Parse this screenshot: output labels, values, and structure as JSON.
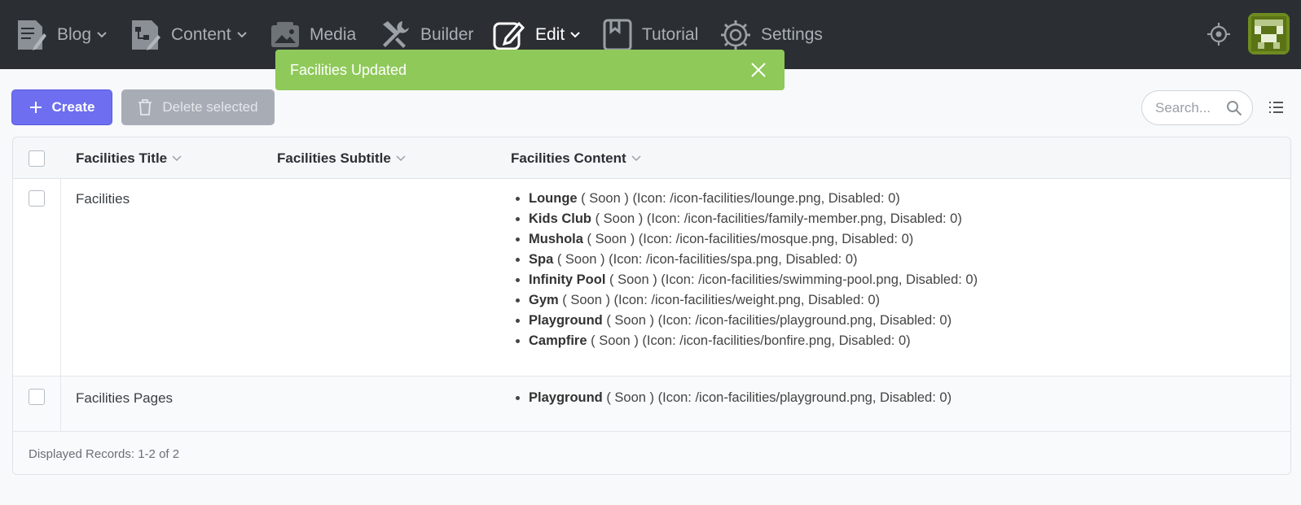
{
  "nav": {
    "items": [
      {
        "label": "Blog",
        "icon": "blog-icon",
        "dropdown": true
      },
      {
        "label": "Content",
        "icon": "content-icon",
        "dropdown": true
      },
      {
        "label": "Media",
        "icon": "media-icon",
        "dropdown": false
      },
      {
        "label": "Builder",
        "icon": "builder-icon",
        "dropdown": false
      },
      {
        "label": "Edit",
        "icon": "edit-icon",
        "dropdown": true,
        "active": true
      },
      {
        "label": "Tutorial",
        "icon": "tutorial-icon",
        "dropdown": false
      },
      {
        "label": "Settings",
        "icon": "settings-icon",
        "dropdown": false
      }
    ]
  },
  "toast": {
    "message": "Facilities Updated",
    "color": "#8fc95a"
  },
  "toolbar": {
    "create_label": "Create",
    "delete_label": "Delete selected",
    "search_placeholder": "Search..."
  },
  "table": {
    "columns": [
      "Facilities Title",
      "Facilities Subtitle",
      "Facilities Content"
    ],
    "rows": [
      {
        "title": "Facilities",
        "subtitle": "",
        "content": [
          {
            "name": "Lounge",
            "detail": " ( Soon ) (Icon: /icon-facilities/lounge.png, Disabled: 0)"
          },
          {
            "name": "Kids Club",
            "detail": " ( Soon ) (Icon: /icon-facilities/family-member.png, Disabled: 0)"
          },
          {
            "name": "Mushola",
            "detail": " ( Soon ) (Icon: /icon-facilities/mosque.png, Disabled: 0)"
          },
          {
            "name": "Spa",
            "detail": " ( Soon ) (Icon: /icon-facilities/spa.png, Disabled: 0)"
          },
          {
            "name": "Infinity Pool",
            "detail": " ( Soon ) (Icon: /icon-facilities/swimming-pool.png, Disabled: 0)"
          },
          {
            "name": "Gym",
            "detail": " ( Soon ) (Icon: /icon-facilities/weight.png, Disabled: 0)"
          },
          {
            "name": "Playground",
            "detail": " ( Soon ) (Icon: /icon-facilities/playground.png, Disabled: 0)"
          },
          {
            "name": "Campfire",
            "detail": " ( Soon ) (Icon: /icon-facilities/bonfire.png, Disabled: 0)"
          }
        ]
      },
      {
        "title": "Facilities Pages",
        "subtitle": "",
        "content": [
          {
            "name": "Playground",
            "detail": " ( Soon ) (Icon: /icon-facilities/playground.png, Disabled: 0)"
          }
        ]
      }
    ],
    "footer": "Displayed Records: 1-2 of 2"
  },
  "colors": {
    "topbar": "#2b2f33",
    "accent": "#6e6ef0",
    "toast": "#8fc95a",
    "avatar": "#6e8b1f"
  }
}
